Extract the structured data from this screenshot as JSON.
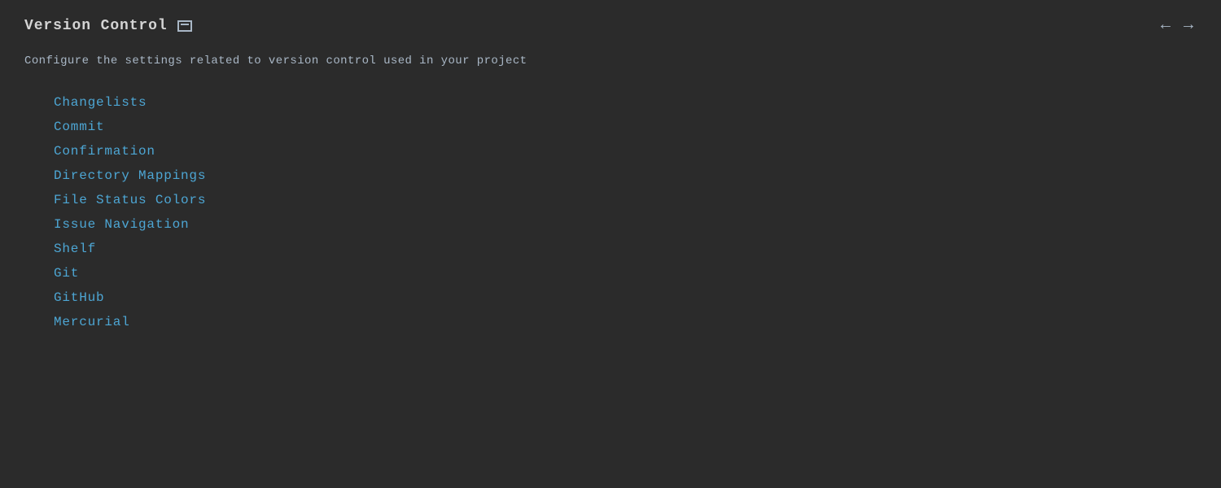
{
  "header": {
    "title": "Version Control",
    "back_arrow": "←",
    "forward_arrow": "→"
  },
  "description": "Configure the settings related to version control used in your project",
  "nav_items": [
    {
      "label": "Changelists",
      "id": "changelists"
    },
    {
      "label": "Commit",
      "id": "commit"
    },
    {
      "label": "Confirmation",
      "id": "confirmation"
    },
    {
      "label": "Directory Mappings",
      "id": "directory-mappings"
    },
    {
      "label": "File Status Colors",
      "id": "file-status-colors"
    },
    {
      "label": "Issue Navigation",
      "id": "issue-navigation"
    },
    {
      "label": "Shelf",
      "id": "shelf"
    },
    {
      "label": "Git",
      "id": "git"
    },
    {
      "label": "GitHub",
      "id": "github"
    },
    {
      "label": "Mercurial",
      "id": "mercurial"
    }
  ]
}
